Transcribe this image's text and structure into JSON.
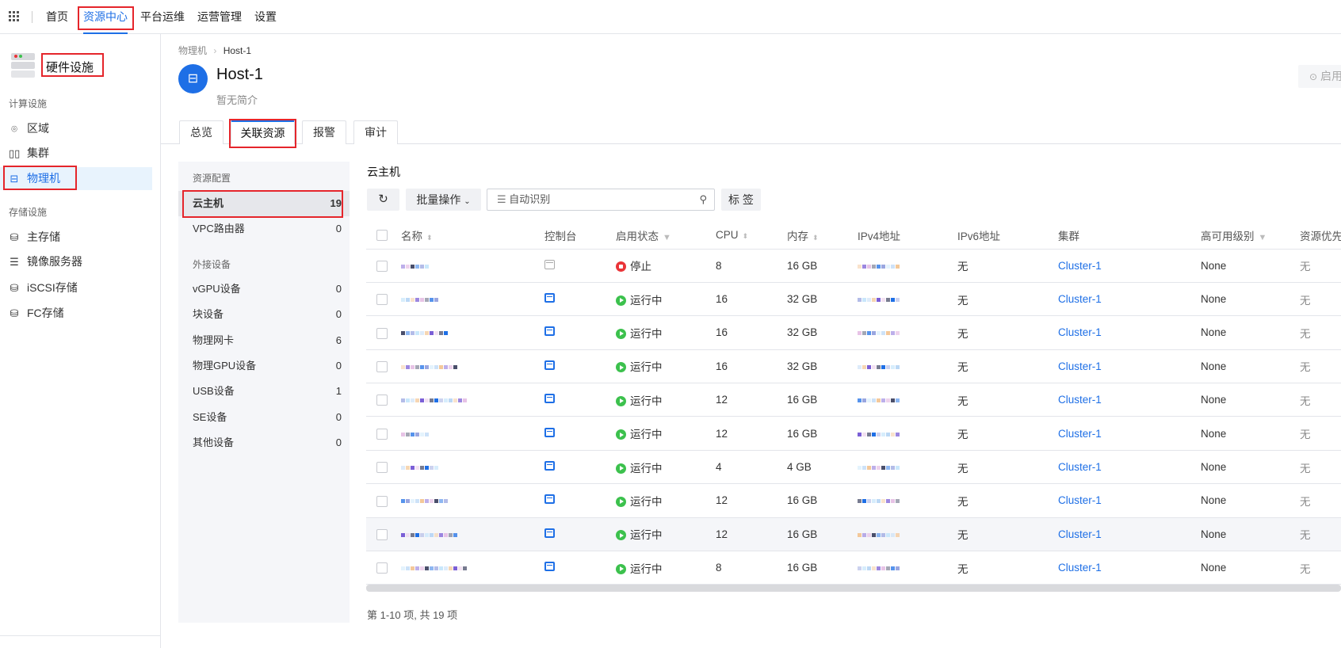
{
  "topnav": {
    "items": [
      {
        "label": "首页"
      },
      {
        "label": "资源中心",
        "active": true
      },
      {
        "label": "平台运维"
      },
      {
        "label": "运营管理"
      },
      {
        "label": "设置"
      }
    ]
  },
  "sidebar": {
    "title": "硬件设施",
    "groups": [
      {
        "label": "计算设施",
        "items": [
          {
            "label": "区域",
            "icon": "map-pin-icon"
          },
          {
            "label": "集群",
            "icon": "cluster-icon"
          },
          {
            "label": "物理机",
            "icon": "host-icon",
            "active": true
          }
        ]
      },
      {
        "label": "存储设施",
        "items": [
          {
            "label": "主存储",
            "icon": "database-icon"
          },
          {
            "label": "镜像服务器",
            "icon": "server-icon"
          },
          {
            "label": "iSCSI存储",
            "icon": "database-icon"
          },
          {
            "label": "FC存储",
            "icon": "database-icon"
          }
        ]
      }
    ]
  },
  "breadcrumb": {
    "parent": "物理机",
    "current": "Host-1"
  },
  "header": {
    "title": "Host-1",
    "description": "暂无简介",
    "enable_button": "启用"
  },
  "tabs": [
    {
      "label": "总览"
    },
    {
      "label": "关联资源",
      "active": true
    },
    {
      "label": "报警"
    },
    {
      "label": "审计"
    }
  ],
  "resource_panel": {
    "group1": "资源配置",
    "items1": [
      {
        "label": "云主机",
        "count": "19",
        "active": true
      },
      {
        "label": "VPC路由器",
        "count": "0"
      }
    ],
    "group2": "外接设备",
    "items2": [
      {
        "label": "vGPU设备",
        "count": "0"
      },
      {
        "label": "块设备",
        "count": "0"
      },
      {
        "label": "物理网卡",
        "count": "6"
      },
      {
        "label": "物理GPU设备",
        "count": "0"
      },
      {
        "label": "USB设备",
        "count": "1"
      },
      {
        "label": "SE设备",
        "count": "0"
      },
      {
        "label": "其他设备",
        "count": "0"
      }
    ]
  },
  "main": {
    "heading": "云主机",
    "toolbar": {
      "batch_label": "批量操作",
      "search_placeholder": "自动识别",
      "tag_label": "标 签"
    },
    "columns": [
      "名称",
      "控制台",
      "启用状态",
      "CPU",
      "内存",
      "IPv4地址",
      "IPv6地址",
      "集群",
      "高可用级别",
      "资源优先"
    ],
    "rows": [
      {
        "status": "停止",
        "state": "stopped",
        "cpu": "8",
        "memory": "16 GB",
        "ipv6": "无",
        "cluster": "Cluster-1",
        "ha": "None",
        "priority": "无"
      },
      {
        "status": "运行中",
        "state": "running",
        "cpu": "16",
        "memory": "32 GB",
        "ipv6": "无",
        "cluster": "Cluster-1",
        "ha": "None",
        "priority": "无"
      },
      {
        "status": "运行中",
        "state": "running",
        "cpu": "16",
        "memory": "32 GB",
        "ipv6": "无",
        "cluster": "Cluster-1",
        "ha": "None",
        "priority": "无"
      },
      {
        "status": "运行中",
        "state": "running",
        "cpu": "16",
        "memory": "32 GB",
        "ipv6": "无",
        "cluster": "Cluster-1",
        "ha": "None",
        "priority": "无"
      },
      {
        "status": "运行中",
        "state": "running",
        "cpu": "12",
        "memory": "16 GB",
        "ipv6": "无",
        "cluster": "Cluster-1",
        "ha": "None",
        "priority": "无"
      },
      {
        "status": "运行中",
        "state": "running",
        "cpu": "12",
        "memory": "16 GB",
        "ipv6": "无",
        "cluster": "Cluster-1",
        "ha": "None",
        "priority": "无"
      },
      {
        "status": "运行中",
        "state": "running",
        "cpu": "4",
        "memory": "4 GB",
        "ipv6": "无",
        "cluster": "Cluster-1",
        "ha": "None",
        "priority": "无"
      },
      {
        "status": "运行中",
        "state": "running",
        "cpu": "12",
        "memory": "16 GB",
        "ipv6": "无",
        "cluster": "Cluster-1",
        "ha": "None",
        "priority": "无"
      },
      {
        "status": "运行中",
        "state": "running",
        "cpu": "12",
        "memory": "16 GB",
        "ipv6": "无",
        "cluster": "Cluster-1",
        "ha": "None",
        "priority": "无"
      },
      {
        "status": "运行中",
        "state": "running",
        "cpu": "8",
        "memory": "16 GB",
        "ipv6": "无",
        "cluster": "Cluster-1",
        "ha": "None",
        "priority": "无"
      }
    ],
    "pagination": "第 1-10 项, 共 19 项"
  },
  "colors": {
    "accent": "#1e6fe6",
    "running": "#3cc14d",
    "stopped": "#ea3438",
    "annotation": "#e5252b"
  }
}
